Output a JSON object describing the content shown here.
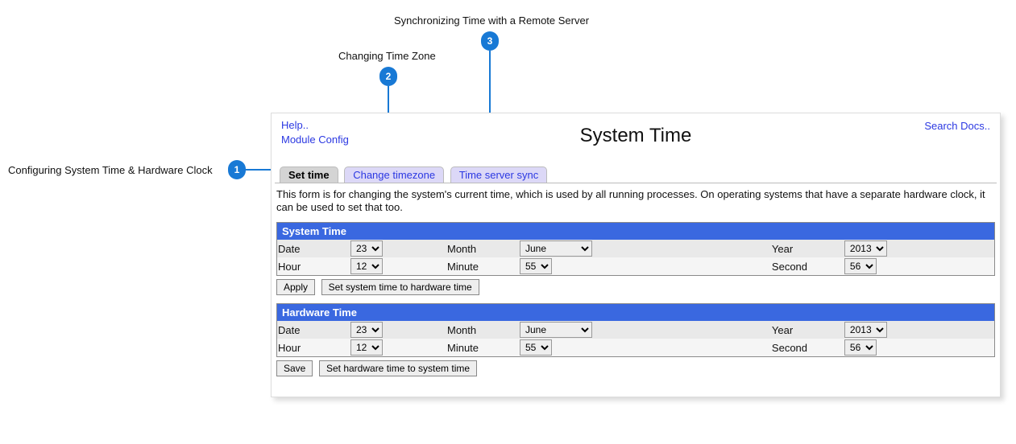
{
  "callouts": {
    "c1": "Configuring System Time & Hardware Clock",
    "c2": "Changing Time Zone",
    "c3": "Synchronizing Time with a Remote Server",
    "n1": "1",
    "n2": "2",
    "n3": "3"
  },
  "header": {
    "help": "Help..",
    "module_config": "Module Config",
    "title": "System Time",
    "search_docs": "Search Docs.."
  },
  "tabs": {
    "set_time": "Set time",
    "change_tz": "Change timezone",
    "ts_sync": "Time server sync"
  },
  "description": "This form is for changing the system's current time, which is used by all running processes. On operating systems that have a separate hardware clock, it can be used to set that too.",
  "system_time": {
    "heading": "System Time",
    "labels": {
      "date": "Date",
      "month": "Month",
      "year": "Year",
      "hour": "Hour",
      "minute": "Minute",
      "second": "Second"
    },
    "values": {
      "date": "23",
      "month": "June",
      "year": "2013",
      "hour": "12",
      "minute": "55",
      "second": "56"
    },
    "buttons": {
      "apply": "Apply",
      "sync": "Set system time to hardware time"
    }
  },
  "hardware_time": {
    "heading": "Hardware Time",
    "labels": {
      "date": "Date",
      "month": "Month",
      "year": "Year",
      "hour": "Hour",
      "minute": "Minute",
      "second": "Second"
    },
    "values": {
      "date": "23",
      "month": "June",
      "year": "2013",
      "hour": "12",
      "minute": "55",
      "second": "56"
    },
    "buttons": {
      "save": "Save",
      "sync": "Set hardware time to system time"
    }
  }
}
